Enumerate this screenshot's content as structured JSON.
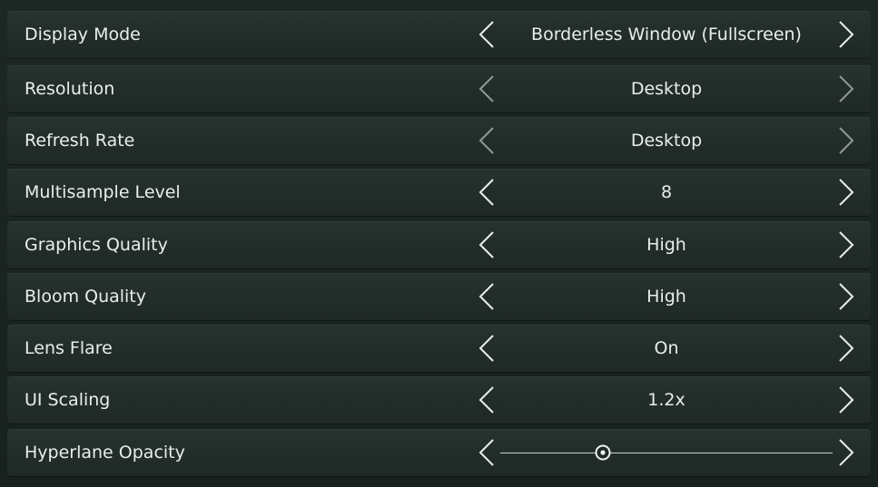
{
  "settings": [
    {
      "label": "Display Mode",
      "value": "Borderless Window (Fullscreen)",
      "left_enabled": true,
      "right_enabled": true
    },
    {
      "label": "Resolution",
      "value": "Desktop",
      "left_enabled": false,
      "right_enabled": false
    },
    {
      "label": "Refresh Rate",
      "value": "Desktop",
      "left_enabled": false,
      "right_enabled": false
    },
    {
      "label": "Multisample Level",
      "value": "8",
      "left_enabled": true,
      "right_enabled": true
    },
    {
      "label": "Graphics Quality",
      "value": "High",
      "left_enabled": true,
      "right_enabled": true
    },
    {
      "label": "Bloom Quality",
      "value": "High",
      "left_enabled": true,
      "right_enabled": true
    },
    {
      "label": "Lens Flare",
      "value": "On",
      "left_enabled": true,
      "right_enabled": true
    },
    {
      "label": "UI Scaling",
      "value": "1.2x",
      "left_enabled": true,
      "right_enabled": true
    }
  ],
  "hyperlane_opacity": {
    "label": "Hyperlane Opacity",
    "level": 0.31
  },
  "colors": {
    "background": "#1a2420",
    "row": "#25302c",
    "text": "#e8eeeb",
    "arrow_enabled": "#e8eeeb",
    "arrow_disabled": "#8f9995"
  }
}
